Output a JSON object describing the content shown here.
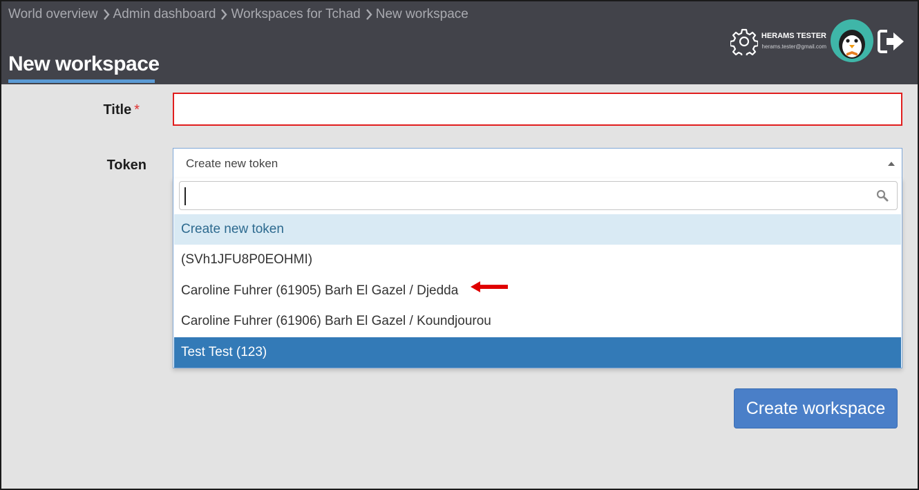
{
  "breadcrumb": [
    "World overview",
    "Admin dashboard",
    "Workspaces for Tchad",
    "New workspace"
  ],
  "page": {
    "title": "New workspace"
  },
  "user": {
    "name": "HERAMS TESTER",
    "email": "herams.tester@gmail.com"
  },
  "form": {
    "title_label": "Title",
    "required_mark": "*",
    "title_value": "",
    "token_label": "Token",
    "token_selected": "Create new token",
    "search_value": "",
    "options": [
      "Create new token",
      "(SVh1JFU8P0EOHMI)",
      "Caroline Fuhrer (61905) Barh El Gazel / Djedda",
      "Caroline Fuhrer (61906) Barh El Gazel / Koundjourou",
      "Test Test (123)"
    ],
    "submit_label": "Create workspace"
  },
  "colors": {
    "header_bg": "#42434a",
    "accent": "#5b9bd5",
    "option_selected": "#337ab7",
    "option_hover": "#d9eaf4",
    "error_border": "#e11d1d",
    "annotation_arrow": "#e00000",
    "button": "#4a7fc8"
  }
}
